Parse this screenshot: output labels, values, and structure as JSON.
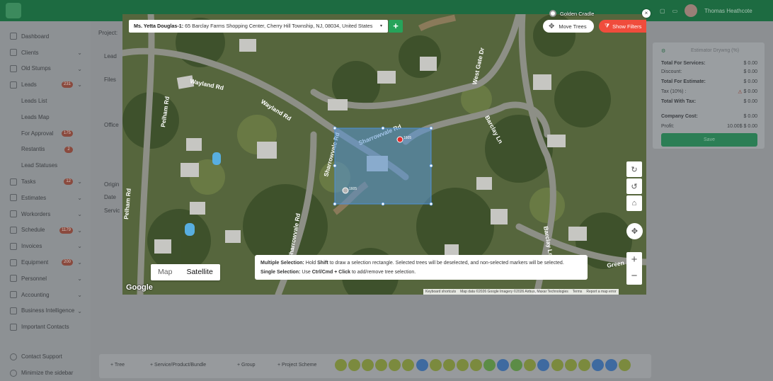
{
  "user": {
    "name": "Thomas Heathcote"
  },
  "sidebar": {
    "items": [
      {
        "label": "Dashboard"
      },
      {
        "label": "Clients",
        "chevron": true
      },
      {
        "label": "Old Stumps",
        "chevron": true
      },
      {
        "label": "Leads",
        "count": "231",
        "chevron": true
      },
      {
        "label": "Leads List",
        "sub": true
      },
      {
        "label": "Leads Map",
        "sub": true
      },
      {
        "label": "For Approval",
        "count": "175",
        "sub": true
      },
      {
        "label": "Restantis",
        "count": "2",
        "sub": true
      },
      {
        "label": "Lead Statuses",
        "sub": true
      },
      {
        "label": "Tasks",
        "count": "12",
        "chevron": true
      },
      {
        "label": "Estimates",
        "chevron": true
      },
      {
        "label": "Workorders",
        "chevron": true
      },
      {
        "label": "Schedule",
        "count": "1179",
        "chevron": true
      },
      {
        "label": "Invoices",
        "chevron": true
      },
      {
        "label": "Equipment",
        "count": "200",
        "chevron": true
      },
      {
        "label": "Personnel",
        "chevron": true
      },
      {
        "label": "Accounting",
        "chevron": true
      },
      {
        "label": "Business Intelligence",
        "chevron": true
      },
      {
        "label": "Important Contacts"
      }
    ],
    "footer": [
      {
        "label": "Contact Support"
      },
      {
        "label": "Minimize the sidebar"
      }
    ]
  },
  "project": {
    "title": "Project:",
    "labels": [
      "Lead",
      "Files",
      "Office",
      "Origin",
      "Date",
      "Servic"
    ]
  },
  "summary": {
    "estimator_placeholder": "Estimator Drywng (%)",
    "rows": [
      {
        "label": "Total For Services:",
        "value": "$ 0.00",
        "bold": true
      },
      {
        "label": "Discount:",
        "value": "$ 0.00"
      },
      {
        "label": "Total For Estimate:",
        "value": "$ 0.00",
        "bold": true
      },
      {
        "label": "Tax (10%) :",
        "value": "$ 0.00",
        "warn": true
      },
      {
        "label": "Total With Tax:",
        "value": "$ 0.00",
        "bold": true
      },
      {
        "label": "Company Cost:",
        "value": "$ 0.00",
        "bold": true
      },
      {
        "label": "Profit:",
        "value": "10.00$ $ 0.00"
      }
    ],
    "save_label": "Save"
  },
  "bottom_bar": {
    "buttons": [
      {
        "label": "+ Tree"
      },
      {
        "label": "+ Service/Product/Bundle"
      },
      {
        "label": "+ Group"
      },
      {
        "label": "+ Project Scheme"
      }
    ],
    "tool_count": 22
  },
  "map": {
    "address_client": "Ms. Yetta Douglas-1:",
    "address": " 65 Barclay Farms Shopping Center, Cherry Hill Township, NJ, 08034, United States",
    "move_trees_label": "Move Trees",
    "show_filters_label": "Show Filters",
    "golden_label": "Golden Cradle",
    "map_type": {
      "map": "Map",
      "satellite": "Satellite",
      "selected": "satellite"
    },
    "streets": [
      "Wayland Rd",
      "Wayland Rd",
      "Sharrowvale Rd",
      "Sharrowvale Rd",
      "Sharrowvale Rd",
      "Pelham Rd",
      "Pelham Rd",
      "West Gate Dr",
      "Barclay Ln",
      "Barclay Ln",
      "Green"
    ],
    "selection_labels": [
      "1605",
      "1605"
    ],
    "help": {
      "multi_title": "Multiple Selection:",
      "multi_text_a": " Hold ",
      "multi_key": "Shift",
      "multi_text_b": " to draw a selection rectangle. Selected trees will be deselected, and non-selected markers will be selected.",
      "single_title": "Single Selection:",
      "single_text_a": " Use ",
      "single_key": "Ctrl/Cmd + Click",
      "single_text_b": " to add/remove tree selection."
    },
    "attribution": [
      "Keyboard shortcuts",
      "Map data ©2026 Google Imagery ©2026 Airbus, Maxar Technologies",
      "Terms",
      "Report a map error"
    ],
    "google": "Google"
  }
}
